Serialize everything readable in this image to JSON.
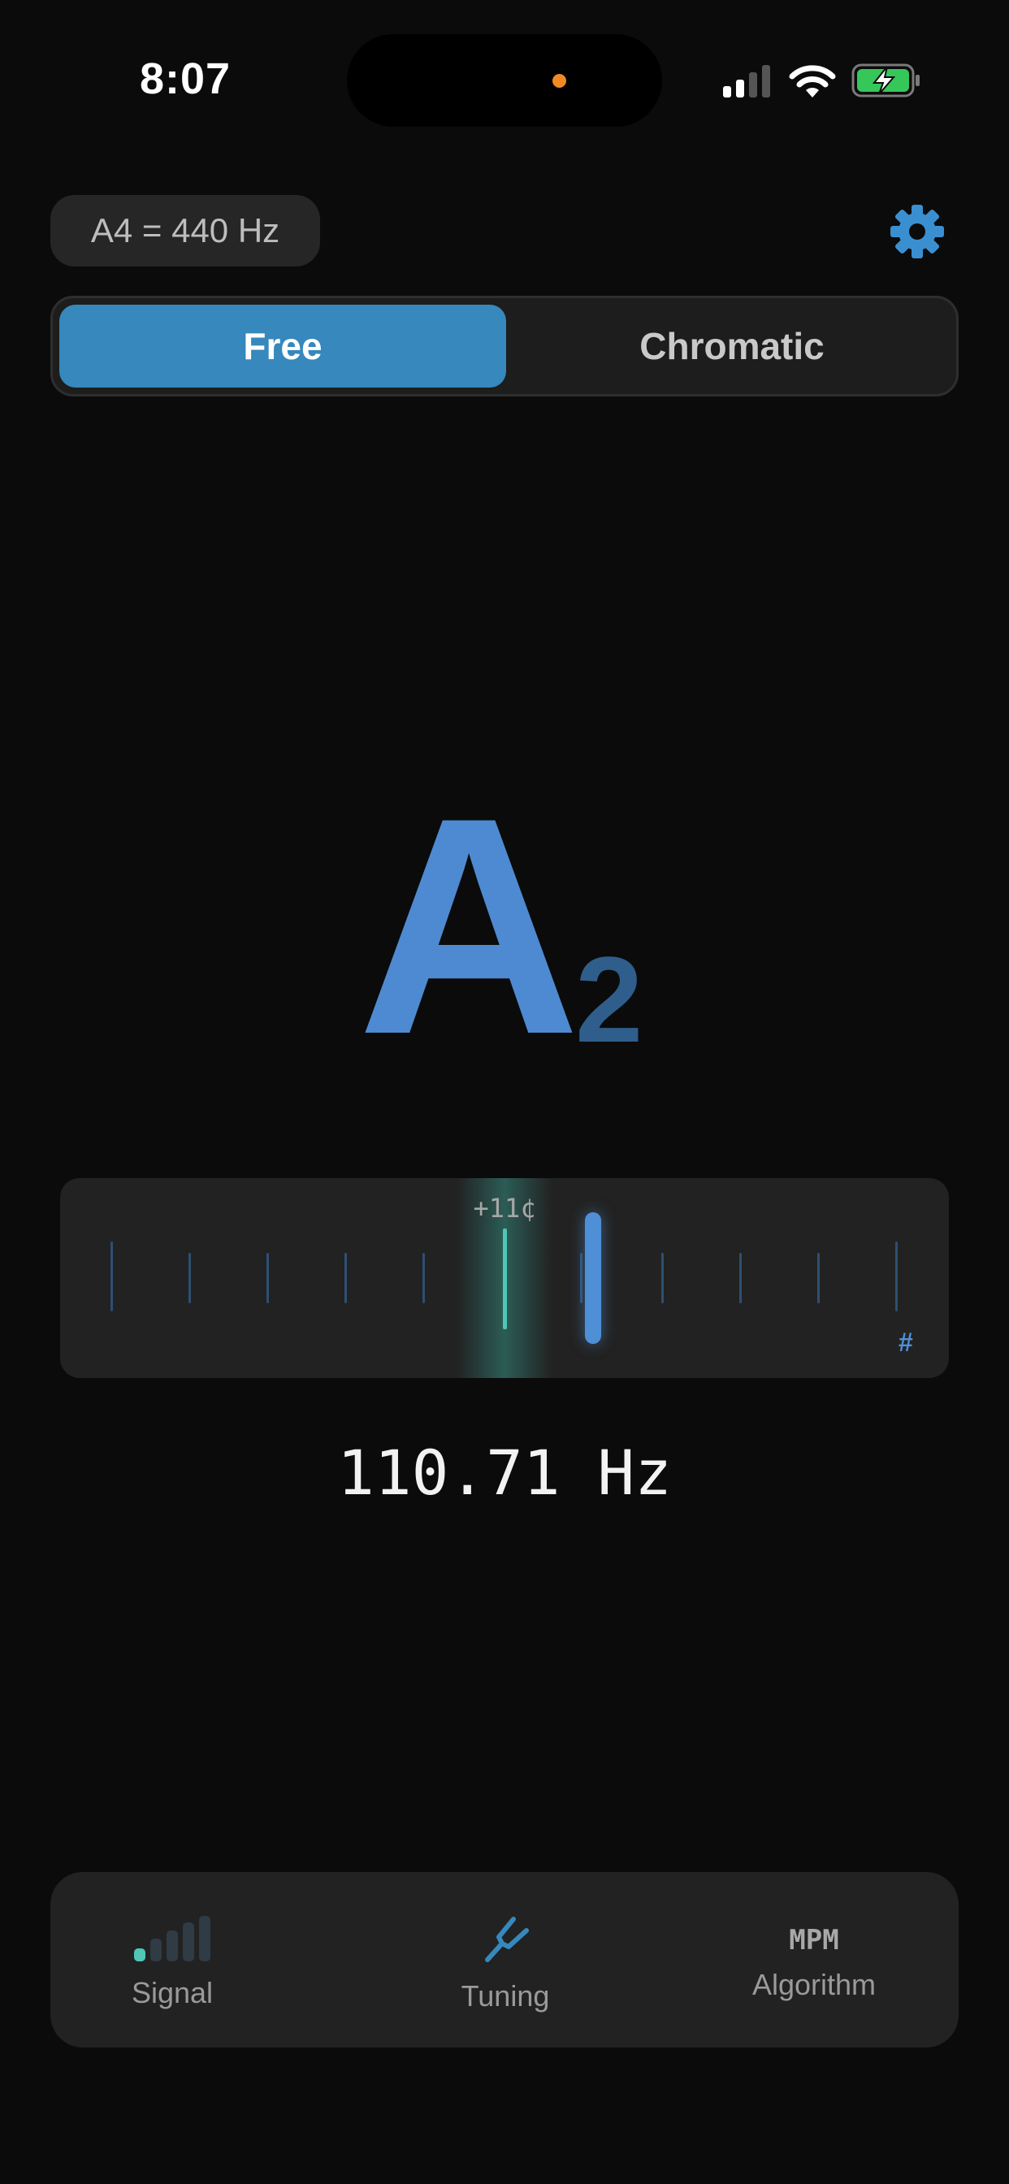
{
  "status_bar": {
    "time": "8:07"
  },
  "header": {
    "reference_pitch": "A4 = 440 Hz",
    "settings_icon": "gear-icon"
  },
  "mode_selector": {
    "options": [
      "Free",
      "Chromatic"
    ],
    "selected": "Free"
  },
  "note": {
    "letter": "A",
    "octave": "2"
  },
  "meter": {
    "cents_label": "+11¢",
    "cents": 11,
    "sharp_symbol": "#"
  },
  "frequency": "110.71 Hz",
  "bottom_bar": {
    "signal_label": "Signal",
    "signal_level_bars": 1,
    "signal_total_bars": 5,
    "tuning_label": "Tuning",
    "algorithm_value": "MPM",
    "algorithm_label": "Algorithm"
  },
  "colors": {
    "accent_blue": "#3688bd",
    "note_blue": "#4e8ad1",
    "in_tune_teal": "#4fc6b6",
    "battery_green": "#35c759",
    "mic_indicator": "#f08a24"
  }
}
